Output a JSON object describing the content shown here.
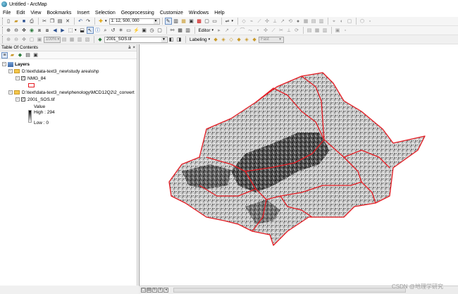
{
  "window": {
    "title": "Untitled - ArcMap"
  },
  "menu": [
    "File",
    "Edit",
    "View",
    "Bookmarks",
    "Insert",
    "Selection",
    "Geoprocessing",
    "Customize",
    "Windows",
    "Help"
  ],
  "toolbar": {
    "scale_value": "1: 12, 500, 000",
    "zoom_value": "100%",
    "editor_label": "Editor",
    "layer_combo": "2001_SOS.tif",
    "labeling_label": "Labeling",
    "fast_label": "Fast"
  },
  "toc": {
    "title": "Table Of Contents",
    "pin_glyph": "à",
    "close_glyph": "×",
    "root_label": "Layers",
    "group1_path": "D:\\text\\data-text3_new\\study area\\shp",
    "layer1_name": "NMG_84",
    "group2_path": "D:\\text\\data-text3_new\\phenology\\MCD12Q2\\2_convert",
    "layer2_name": "2001_SOS.tif",
    "value_label": "Value",
    "high_label": "High : 294",
    "low_label": "Low : 0"
  },
  "colors": {
    "boundary": "#e51c23",
    "raster_light": "#d0d0d0",
    "raster_dark": "#2a2a2a"
  },
  "watermark": "CSDN @地理学研究"
}
